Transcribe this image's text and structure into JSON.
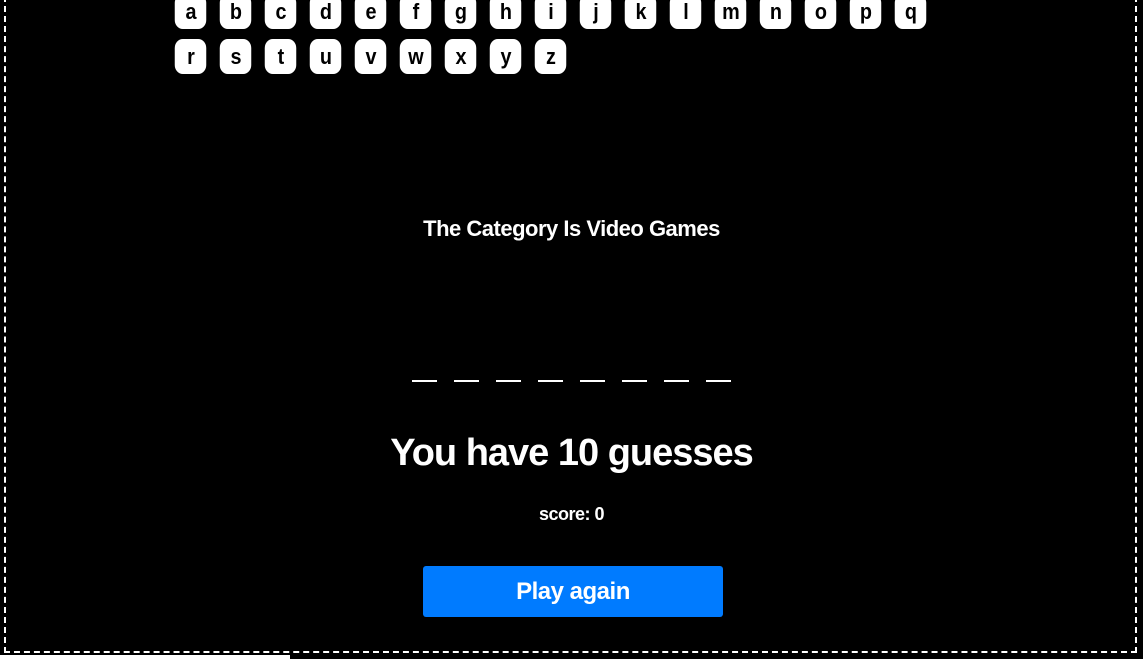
{
  "keyboard": {
    "rows": [
      [
        "a",
        "b",
        "c",
        "d",
        "e",
        "f",
        "g",
        "h",
        "i",
        "j",
        "k",
        "l",
        "m",
        "n",
        "o",
        "p",
        "q"
      ],
      [
        "r",
        "s",
        "t",
        "u",
        "v",
        "w",
        "x",
        "y",
        "z"
      ]
    ]
  },
  "category": {
    "text": "The Category Is Video Games"
  },
  "word": {
    "blank_count": 8,
    "blank_char": "_"
  },
  "status": {
    "guesses_text": "You have 10 guesses",
    "score_text": "score: 0"
  },
  "play_again": {
    "label": "Play again"
  },
  "colors": {
    "background": "#000000",
    "key_background": "#ffffff",
    "key_text": "#000000",
    "button": "#007bff",
    "text": "#ffffff"
  }
}
